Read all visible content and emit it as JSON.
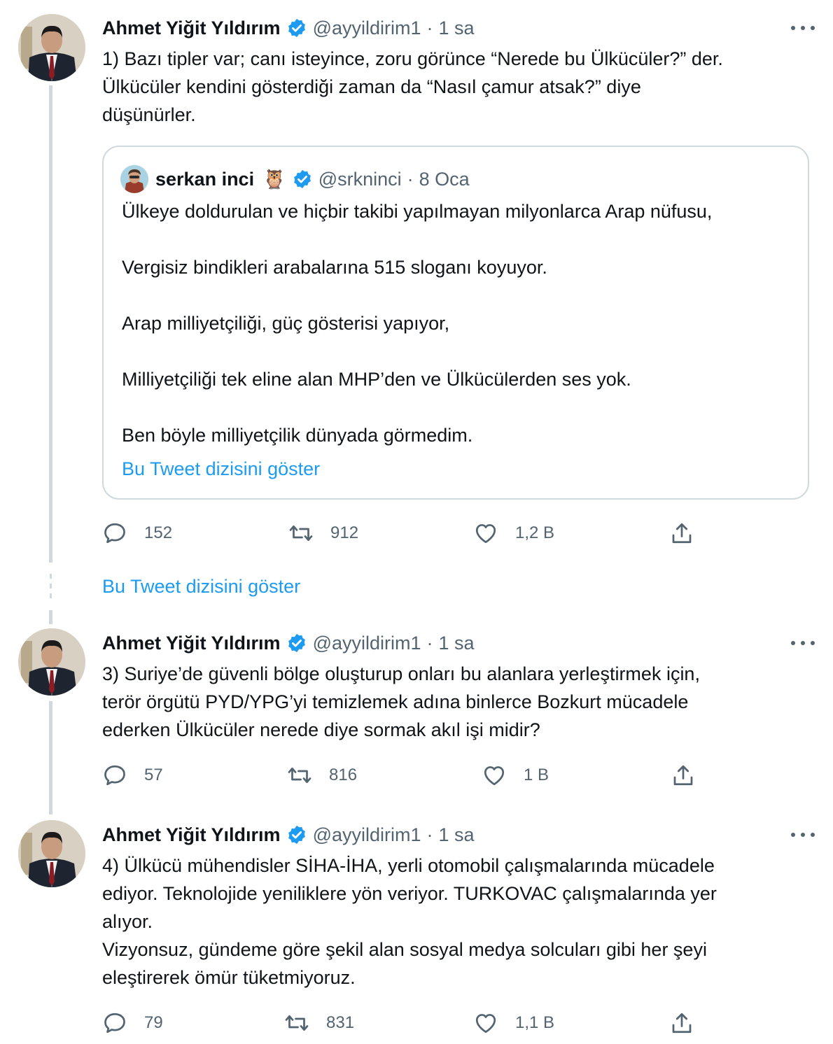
{
  "tweets": [
    {
      "author_name": "Ahmet Yiğit Yıldırım",
      "handle": "@ayyildirim1",
      "separator": "·",
      "time": "1 sa",
      "text": [
        "1) Bazı tipler var; canı isteyince, zoru görünce “Nerede bu Ülkücüler?” der.",
        "Ülkücüler kendini gösterdiği zaman da “Nasıl çamur atsak?” diye",
        "düşünürler."
      ],
      "replies": "152",
      "retweets": "912",
      "likes": "1,2 B"
    },
    {
      "author_name": "Ahmet Yiğit Yıldırım",
      "handle": "@ayyildirim1",
      "separator": "·",
      "time": "1 sa",
      "text": [
        "3) Suriye’de güvenli bölge oluşturup onları bu alanlara yerleştirmek için,",
        "terör örgütü PYD/YPG’yi temizlemek adına binlerce Bozkurt mücadele",
        "ederken Ülkücüler nerede diye sormak akıl işi midir?"
      ],
      "replies": "57",
      "retweets": "816",
      "likes": "1 B"
    },
    {
      "author_name": "Ahmet Yiğit Yıldırım",
      "handle": "@ayyildirim1",
      "separator": "·",
      "time": "1 sa",
      "text": [
        "4) Ülkücü mühendisler SİHA-İHA, yerli otomobil çalışmalarında  mücadele",
        "ediyor. Teknolojide yeniliklere yön veriyor. TURKOVAC çalışmalarında yer",
        "alıyor.",
        "Vizyonsuz, gündeme göre şekil alan sosyal medya solcuları gibi her şeyi",
        "eleştirerek ömür tüketmiyoruz."
      ],
      "replies": "79",
      "retweets": "831",
      "likes": "1,1 B"
    }
  ],
  "quote": {
    "author_name": "serkan inci",
    "emoji": "🦉",
    "handle": "@srkninci",
    "separator": "·",
    "time": "8 Oca",
    "paragraphs": [
      "Ülkeye doldurulan ve hiçbir takibi yapılmayan milyonlarca Arap nüfusu,",
      "Vergisiz bindikleri arabalarına 515 sloganı koyuyor.",
      "Arap milliyetçiliği, güç gösterisi yapıyor,",
      "Milliyetçiliği tek eline alan MHP’den ve Ülkücülerden ses yok.",
      "Ben böyle milliyetçilik dünyada görmedim."
    ],
    "show_thread": "Bu Tweet dizisini göster"
  },
  "thread_link": "Bu Tweet dizisini göster",
  "colors": {
    "accent": "#1d9bf0",
    "secondary_text": "#536471",
    "border": "#cfd9de"
  },
  "icons": [
    "verified-badge-icon",
    "more-icon",
    "reply-icon",
    "retweet-icon",
    "like-icon",
    "share-icon"
  ]
}
